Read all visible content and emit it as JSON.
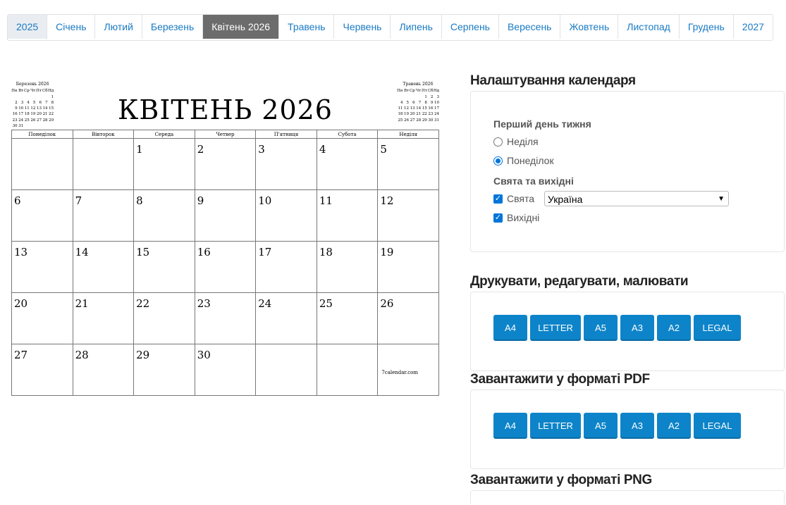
{
  "nav": {
    "items": [
      "2025",
      "Січень",
      "Лютий",
      "Березень",
      "Квітень 2026",
      "Травень",
      "Червень",
      "Липень",
      "Серпень",
      "Вересень",
      "Жовтень",
      "Листопад",
      "Грудень",
      "2027"
    ]
  },
  "calendar": {
    "title": "КВІТЕНЬ 2026",
    "weekdays": [
      "Понеділок",
      "Вівторок",
      "Середа",
      "Четвер",
      "П'ятниця",
      "Субота",
      "Неділя"
    ],
    "weeks": [
      [
        "",
        "",
        "1",
        "2",
        "3",
        "4",
        "5"
      ],
      [
        "6",
        "7",
        "8",
        "9",
        "10",
        "11",
        "12"
      ],
      [
        "13",
        "14",
        "15",
        "16",
        "17",
        "18",
        "19"
      ],
      [
        "20",
        "21",
        "22",
        "23",
        "24",
        "25",
        "26"
      ],
      [
        "27",
        "28",
        "29",
        "30",
        "",
        "",
        ""
      ]
    ],
    "watermark": "7calendar.com",
    "mini_prev": {
      "title": "Березень 2026",
      "head": [
        "Пн",
        "Вт",
        "Ср",
        "Чт",
        "Пт",
        "Сб",
        "Нд"
      ],
      "weeks": [
        [
          "",
          "",
          "",
          "",
          "",
          "",
          "1"
        ],
        [
          "2",
          "3",
          "4",
          "5",
          "6",
          "7",
          "8"
        ],
        [
          "9",
          "10",
          "11",
          "12",
          "13",
          "14",
          "15"
        ],
        [
          "16",
          "17",
          "18",
          "19",
          "20",
          "21",
          "22"
        ],
        [
          "23",
          "24",
          "25",
          "26",
          "27",
          "28",
          "29"
        ],
        [
          "30",
          "31",
          "",
          "",
          "",
          "",
          ""
        ]
      ]
    },
    "mini_next": {
      "title": "Травень 2026",
      "head": [
        "Пн",
        "Вт",
        "Ср",
        "Чт",
        "Пт",
        "Сб",
        "Нд"
      ],
      "weeks": [
        [
          "",
          "",
          "",
          "",
          "1",
          "2",
          "3"
        ],
        [
          "4",
          "5",
          "6",
          "7",
          "8",
          "9",
          "10"
        ],
        [
          "11",
          "12",
          "13",
          "14",
          "15",
          "16",
          "17"
        ],
        [
          "18",
          "19",
          "20",
          "21",
          "22",
          "23",
          "24"
        ],
        [
          "25",
          "26",
          "27",
          "28",
          "29",
          "30",
          "31"
        ]
      ]
    }
  },
  "settings": {
    "heading": "Налаштування календаря",
    "first_day_label": "Перший день тижня",
    "opt_sunday": "Неділя",
    "opt_monday": "Понеділок",
    "holidays_label": "Свята та вихідні",
    "holidays_cb": "Свята",
    "weekends_cb": "Вихідні",
    "country": "Україна"
  },
  "print": {
    "heading": "Друкувати, редагувати, малювати",
    "buttons": [
      "A4",
      "LETTER",
      "A5",
      "A3",
      "A2",
      "LEGAL"
    ]
  },
  "pdf": {
    "heading": "Завантажити у форматі PDF",
    "buttons": [
      "A4",
      "LETTER",
      "A5",
      "A3",
      "A2",
      "LEGAL"
    ]
  },
  "png": {
    "heading": "Завантажити у форматі PNG"
  },
  "colors": {
    "accent": "#0d84c9",
    "active_tab": "#6c6c6c",
    "link": "#1a7bc4"
  }
}
